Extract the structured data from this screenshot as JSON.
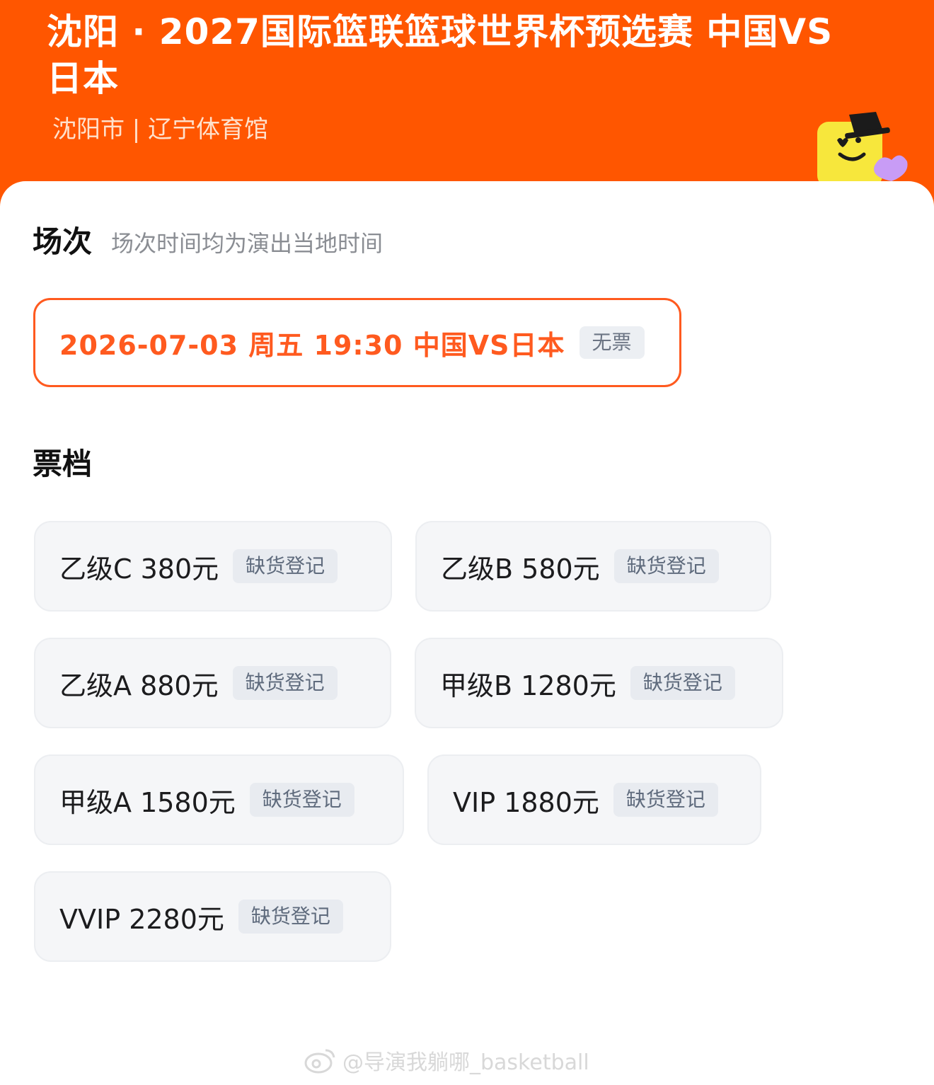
{
  "header": {
    "title": "沈阳 · 2027国际篮联篮球世界杯预选赛 中国VS日本",
    "venue": "沈阳市 | 辽宁体育馆",
    "mascot_icon": "smiley-mascot-icon"
  },
  "session_section": {
    "title": "场次",
    "note": "场次时间均为演出当地时间",
    "session": {
      "label": "2026-07-03  周五 19:30 中国VS日本",
      "badge": "无票"
    }
  },
  "tiers_section": {
    "title": "票档",
    "tiers": [
      {
        "name": "乙级C 380元",
        "badge": "缺货登记"
      },
      {
        "name": "乙级B 580元",
        "badge": "缺货登记"
      },
      {
        "name": "乙级A 880元",
        "badge": "缺货登记"
      },
      {
        "name": "甲级B 1280元",
        "badge": "缺货登记"
      },
      {
        "name": "甲级A 1580元",
        "badge": "缺货登记"
      },
      {
        "name": "VIP 1880元",
        "badge": "缺货登记"
      },
      {
        "name": "VVIP 2280元",
        "badge": "缺货登记"
      }
    ]
  },
  "watermark": {
    "text": "@导演我躺哪_basketball",
    "icon": "weibo-icon"
  },
  "colors": {
    "brand": "#ff5600",
    "accent": "#ff5a1f",
    "badge_bg": "#e8ebf0"
  }
}
